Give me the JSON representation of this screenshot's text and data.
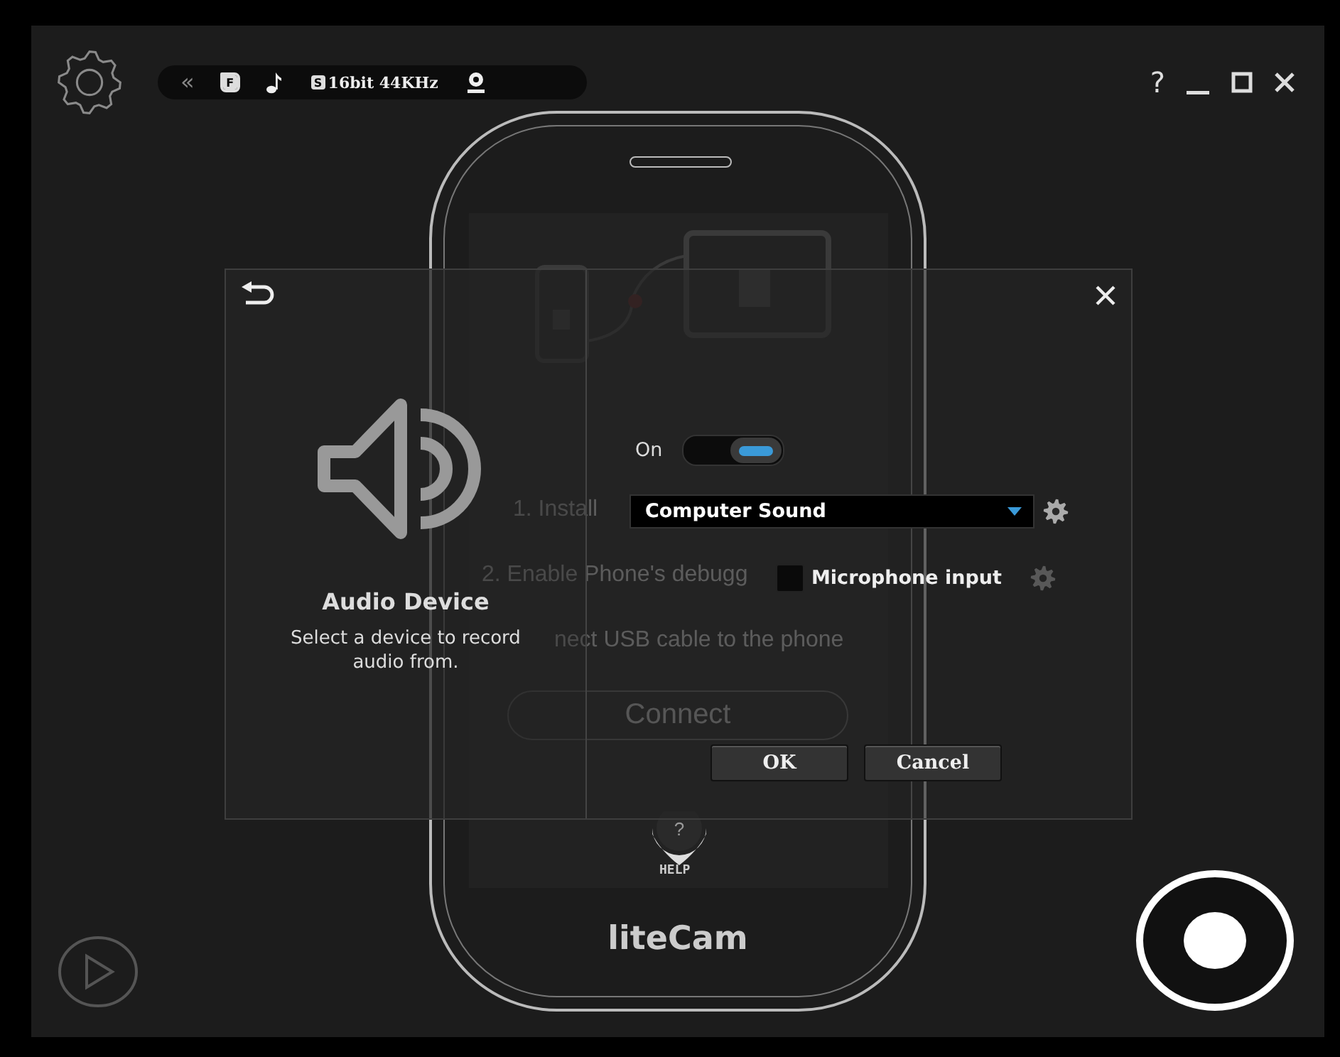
{
  "toolbar": {
    "collapse": "«",
    "screen_badge": "F",
    "audio_badge": "S",
    "audio_format": "16bit 44KHz"
  },
  "window_controls": {
    "help": "?"
  },
  "phone_screen": {
    "steps": [
      "1. Install",
      "2. Enable Phone's debugg",
      "nect USB cable to the phone"
    ],
    "connect_button": "Connect",
    "help_mark": "?",
    "help_label": "HELP"
  },
  "logo": "liteCam",
  "dialog": {
    "title": "Audio Device",
    "description": "Select a device to record audio from.",
    "toggle": {
      "label": "On",
      "on": true
    },
    "source": {
      "value": "Computer Sound"
    },
    "microphone": {
      "label": "Microphone input",
      "checked": false
    },
    "buttons": [
      {
        "label": "OK"
      },
      {
        "label": "Cancel"
      }
    ]
  }
}
